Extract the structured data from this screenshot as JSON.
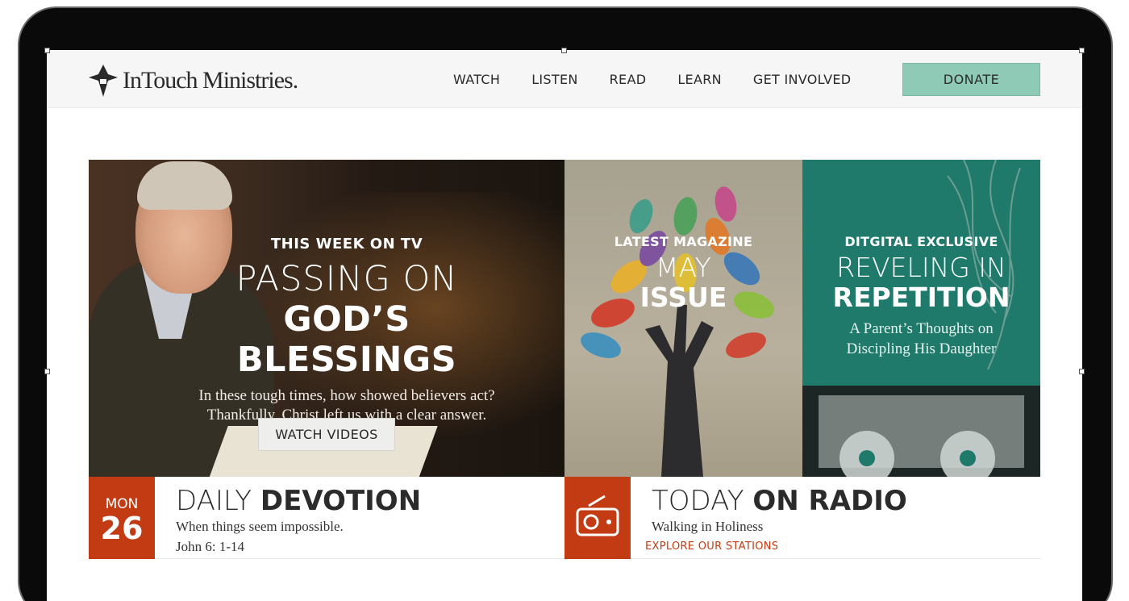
{
  "brand": {
    "logo_text": "InTouch Ministries."
  },
  "nav": {
    "items": [
      "WATCH",
      "LISTEN",
      "READ",
      "LEARN",
      "GET INVOLVED"
    ],
    "donate_label": "DONATE"
  },
  "hero": {
    "tv": {
      "eyebrow": "THIS WEEK ON TV",
      "title_light": "PASSING ON",
      "title_bold": "GOD’S BLESSINGS",
      "desc_line1": "In these tough times, how showed believers act?",
      "desc_line2": "Thankfully, Christ left us with a clear answer.",
      "button_label": "WATCH VIDEOS"
    },
    "magazine": {
      "eyebrow": "LATEST MAGAZINE",
      "title_light": "MAY",
      "title_bold": "ISSUE"
    },
    "digital": {
      "eyebrow": "DITGITAL EXCLUSIVE",
      "title_light": "REVELING IN",
      "title_bold": "REPETITION",
      "desc_line1": "A Parent’s Thoughts on",
      "desc_line2": "Discipling His Daughter"
    }
  },
  "devotion": {
    "day": "MON",
    "date": "26",
    "title_light": "DAILY ",
    "title_bold": "DEVOTION",
    "subtitle": "When things seem impossible.",
    "reference": "John 6: 1-14"
  },
  "radio": {
    "title_light": "TODAY ",
    "title_bold": "ON RADIO",
    "subtitle": "Walking in Holiness",
    "link_label": "EXPLORE OUR STATIONS"
  },
  "colors": {
    "accent_red": "#c23b12",
    "donate_green": "#8fcab7",
    "digital_teal": "#1f7a6b"
  }
}
